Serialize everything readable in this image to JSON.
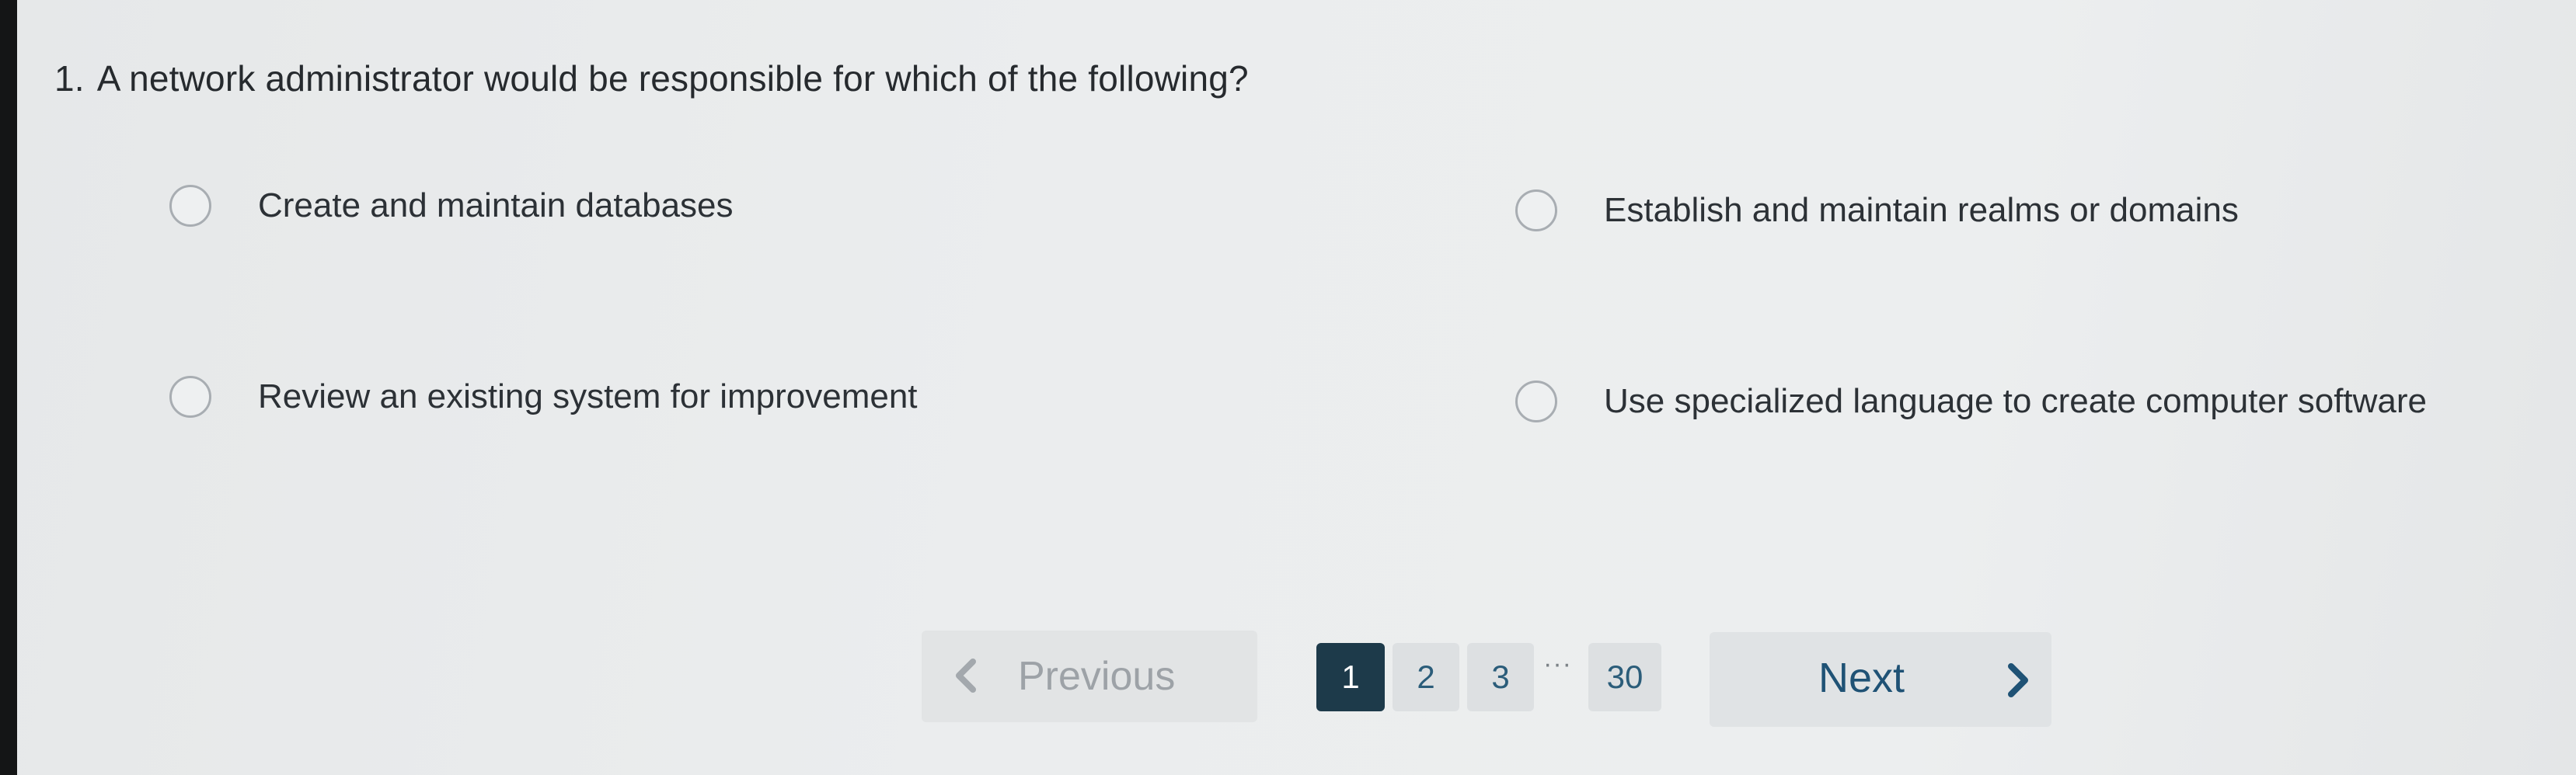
{
  "question": {
    "number": "1.",
    "text": "A network administrator would be responsible for which of the following?"
  },
  "options": [
    {
      "label": "Create and maintain databases",
      "selected": false
    },
    {
      "label": "Establish and maintain realms or domains",
      "selected": false
    },
    {
      "label": "Review an existing system for improvement",
      "selected": false
    },
    {
      "label": "Use specialized language to create computer software",
      "selected": false
    }
  ],
  "pagination": {
    "previous_label": "Previous",
    "previous_icon": "chevron-left-icon",
    "pages": [
      "1",
      "2",
      "3"
    ],
    "ellipsis": "···",
    "last_page": "30",
    "current_page": "1",
    "next_label": "Next",
    "next_icon": "chevron-right-icon"
  },
  "colors": {
    "active_page_bg": "#1d3a4a",
    "link_blue": "#1f5275",
    "disabled_text": "#9da2a7"
  }
}
